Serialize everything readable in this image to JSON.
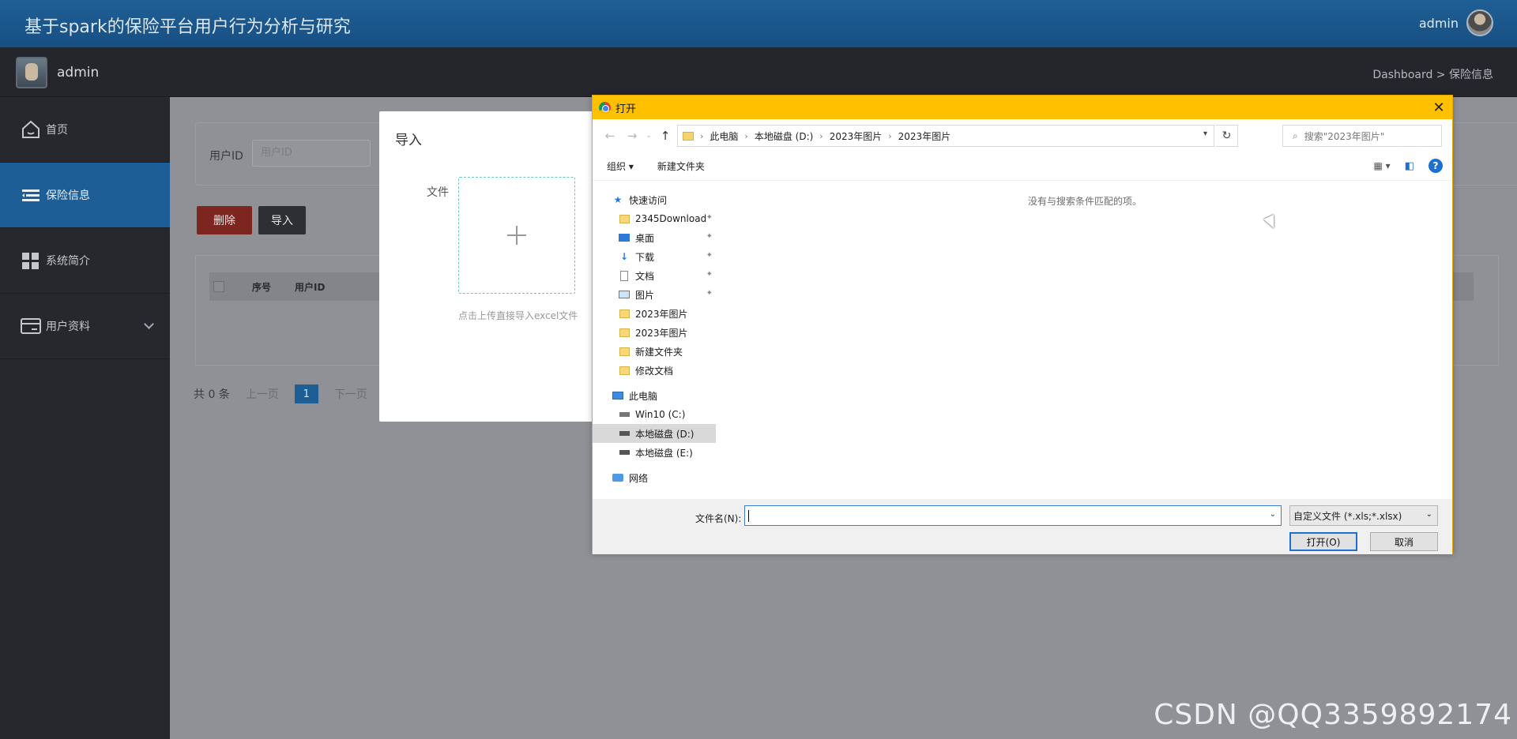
{
  "header": {
    "app_title": "基于spark的保险平台用户行为分析与研究",
    "user_name": "admin"
  },
  "subheader": {
    "sidebar_user": "admin",
    "breadcrumb": "Dashboard > 保险信息"
  },
  "sidebar": {
    "items": [
      {
        "label": "首页",
        "icon": "home-icon"
      },
      {
        "label": "保险信息",
        "icon": "list-icon",
        "active": true
      },
      {
        "label": "系统简介",
        "icon": "grid-icon"
      },
      {
        "label": "用户资料",
        "icon": "card-icon",
        "has_submenu": true
      }
    ]
  },
  "main": {
    "search": {
      "label": "用户ID",
      "placeholder": "用户ID"
    },
    "buttons": {
      "delete": "删除",
      "import": "导入"
    },
    "table": {
      "columns": [
        "序号",
        "用户ID"
      ]
    },
    "pager": {
      "total": "共 0 条",
      "prev": "上一页",
      "current": "1",
      "next": "下一页"
    }
  },
  "import_modal": {
    "title": "导入",
    "file_label": "文件",
    "hint": "点击上传直接导入excel文件"
  },
  "file_dialog": {
    "title": "打开",
    "path": [
      "此电脑",
      "本地磁盘 (D:)",
      "2023年图片",
      "2023年图片"
    ],
    "search_placeholder": "搜索\"2023年图片\"",
    "toolbar": {
      "organize": "组织 ▾",
      "new_folder": "新建文件夹"
    },
    "empty_message": "没有与搜索条件匹配的项。",
    "tree": {
      "quick_access": "快速访问",
      "quick_items": [
        "2345Download",
        "桌面",
        "下载",
        "文档",
        "图片",
        "2023年图片",
        "2023年图片",
        "新建文件夹",
        "修改文档"
      ],
      "this_pc": "此电脑",
      "drives": [
        "Win10 (C:)",
        "本地磁盘 (D:)",
        "本地磁盘 (E:)"
      ],
      "network": "网络"
    },
    "filename_label": "文件名(N):",
    "filename_value": "",
    "filter": "自定义文件 (*.xls;*.xlsx)",
    "open_button": "打开(O)",
    "cancel_button": "取消"
  },
  "watermark": "CSDN @QQ3359892174"
}
